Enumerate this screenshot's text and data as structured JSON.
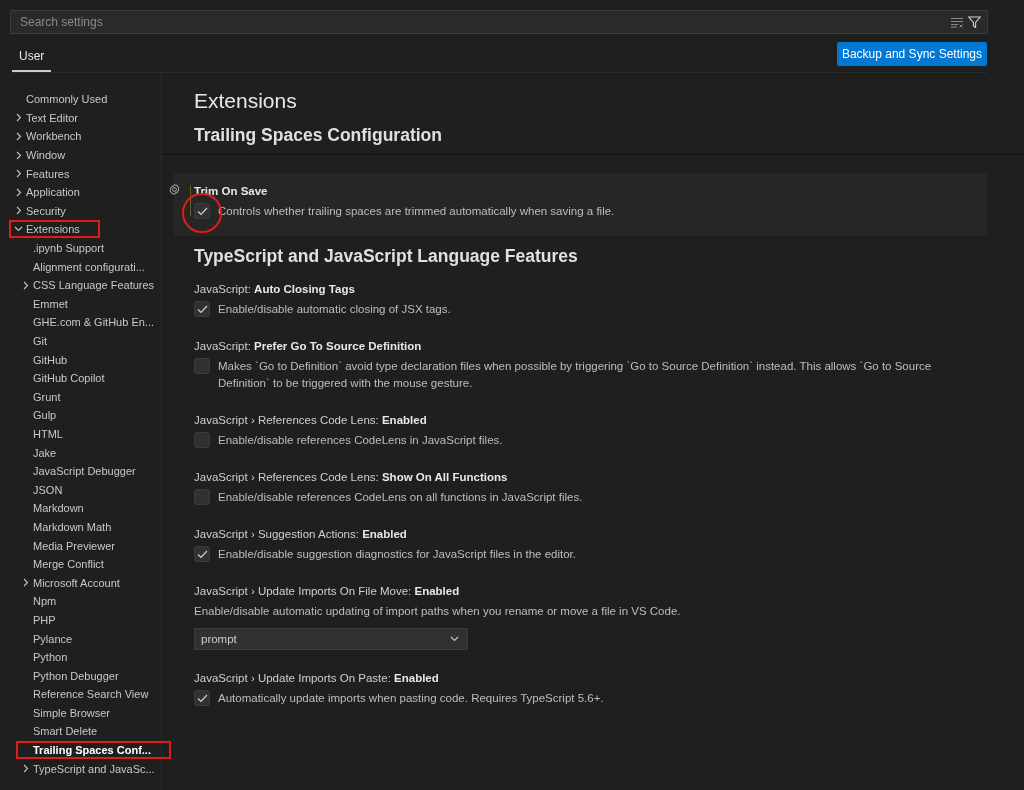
{
  "search": {
    "placeholder": "Search settings"
  },
  "tabs": [
    {
      "label": "User",
      "selected": true
    }
  ],
  "sync_button": "Backup and Sync Settings",
  "sidebar": {
    "items": [
      {
        "kind": "leaf",
        "label": "Commonly Used",
        "selected": false
      },
      {
        "kind": "group",
        "label": "Text Editor",
        "expanded": false,
        "selected": false
      },
      {
        "kind": "group",
        "label": "Workbench",
        "expanded": false,
        "selected": false
      },
      {
        "kind": "group",
        "label": "Window",
        "expanded": false,
        "selected": false
      },
      {
        "kind": "group",
        "label": "Features",
        "expanded": false,
        "selected": false
      },
      {
        "kind": "group",
        "label": "Application",
        "expanded": false,
        "selected": false
      },
      {
        "kind": "group",
        "label": "Security",
        "expanded": false,
        "selected": false
      },
      {
        "kind": "group",
        "label": "Extensions",
        "expanded": true,
        "selected": false,
        "annotated": true,
        "children": [
          {
            "kind": "leaf",
            "label": ".ipynb Support",
            "selected": false
          },
          {
            "kind": "leaf",
            "label": "Alignment configurati...",
            "selected": false
          },
          {
            "kind": "group",
            "label": "CSS Language Features",
            "expanded": false,
            "selected": false
          },
          {
            "kind": "leaf",
            "label": "Emmet",
            "selected": false
          },
          {
            "kind": "leaf",
            "label": "GHE.com & GitHub En...",
            "selected": false
          },
          {
            "kind": "leaf",
            "label": "Git",
            "selected": false
          },
          {
            "kind": "leaf",
            "label": "GitHub",
            "selected": false
          },
          {
            "kind": "leaf",
            "label": "GitHub Copilot",
            "selected": false
          },
          {
            "kind": "leaf",
            "label": "Grunt",
            "selected": false
          },
          {
            "kind": "leaf",
            "label": "Gulp",
            "selected": false
          },
          {
            "kind": "leaf",
            "label": "HTML",
            "selected": false
          },
          {
            "kind": "leaf",
            "label": "Jake",
            "selected": false
          },
          {
            "kind": "leaf",
            "label": "JavaScript Debugger",
            "selected": false
          },
          {
            "kind": "leaf",
            "label": "JSON",
            "selected": false
          },
          {
            "kind": "leaf",
            "label": "Markdown",
            "selected": false
          },
          {
            "kind": "leaf",
            "label": "Markdown Math",
            "selected": false
          },
          {
            "kind": "leaf",
            "label": "Media Previewer",
            "selected": false
          },
          {
            "kind": "leaf",
            "label": "Merge Conflict",
            "selected": false
          },
          {
            "kind": "group",
            "label": "Microsoft Account",
            "expanded": false,
            "selected": false
          },
          {
            "kind": "leaf",
            "label": "Npm",
            "selected": false
          },
          {
            "kind": "leaf",
            "label": "PHP",
            "selected": false
          },
          {
            "kind": "leaf",
            "label": "Pylance",
            "selected": false
          },
          {
            "kind": "leaf",
            "label": "Python",
            "selected": false
          },
          {
            "kind": "leaf",
            "label": "Python Debugger",
            "selected": false
          },
          {
            "kind": "leaf",
            "label": "Reference Search View",
            "selected": false
          },
          {
            "kind": "leaf",
            "label": "Simple Browser",
            "selected": false
          },
          {
            "kind": "leaf",
            "label": "Smart Delete",
            "selected": false
          },
          {
            "kind": "leaf",
            "label": "Trailing Spaces Conf...",
            "selected": true,
            "annotated": true
          },
          {
            "kind": "group",
            "label": "TypeScript and JavaSc...",
            "expanded": false,
            "selected": false
          }
        ]
      }
    ]
  },
  "header": {
    "title": "Extensions",
    "subtitle": "Trailing Spaces Configuration"
  },
  "sections": [
    {
      "settings": [
        {
          "kind": "checkbox",
          "name": "Trim On Save",
          "description": "Controls whether trailing spaces are trimmed automatically when saving a file.",
          "checked": true,
          "focused": true,
          "annotated": true
        }
      ]
    },
    {
      "title": "TypeScript and JavaScript Language Features",
      "settings": [
        {
          "kind": "checkbox",
          "category": "JavaScript: ",
          "name": "Auto Closing Tags",
          "description": "Enable/disable automatic closing of JSX tags.",
          "checked": true
        },
        {
          "kind": "checkbox",
          "category": "JavaScript: ",
          "name": "Prefer Go To Source Definition",
          "description": "Makes `Go to Definition` avoid type declaration files when possible by triggering `Go to Source Definition` instead. This allows `Go to Source Definition` to be triggered with the mouse gesture.",
          "checked": false
        },
        {
          "kind": "checkbox",
          "category": "JavaScript › References Code Lens: ",
          "name": "Enabled",
          "description": "Enable/disable references CodeLens in JavaScript files.",
          "checked": false
        },
        {
          "kind": "checkbox",
          "category": "JavaScript › References Code Lens: ",
          "name": "Show On All Functions",
          "description": "Enable/disable references CodeLens on all functions in JavaScript files.",
          "checked": false
        },
        {
          "kind": "checkbox",
          "category": "JavaScript › Suggestion Actions: ",
          "name": "Enabled",
          "description": "Enable/disable suggestion diagnostics for JavaScript files in the editor.",
          "checked": true
        },
        {
          "kind": "dropdown",
          "category": "JavaScript › Update Imports On File Move: ",
          "name": "Enabled",
          "description": "Enable/disable automatic updating of import paths when you rename or move a file in VS Code.",
          "value": "prompt"
        },
        {
          "kind": "checkbox",
          "category": "JavaScript › Update Imports On Paste: ",
          "name": "Enabled",
          "description": "Automatically update imports when pasting code. Requires TypeScript 5.6+.",
          "checked": true
        }
      ]
    }
  ]
}
